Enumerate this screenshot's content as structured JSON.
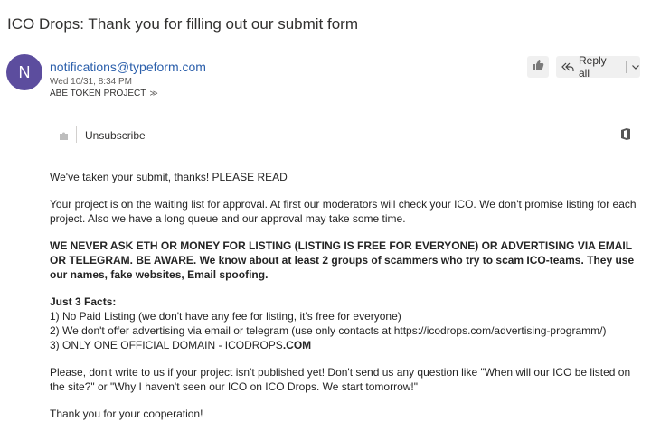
{
  "email": {
    "subject": "ICO Drops: Thank you for filling out our submit form",
    "avatar_letter": "N",
    "avatar_color": "#5c4d9e",
    "sender": "notifications@typeform.com",
    "date": "Wed 10/31, 8:34 PM",
    "to": "ABE TOKEN PROJECT",
    "reply_label": "Reply all",
    "unsubscribe_label": "Unsubscribe",
    "accent_color": "#2b5fab"
  },
  "icons": {
    "react": "thumbs-up-icon",
    "reply": "reply-all-icon",
    "dropdown": "chevron-down-icon",
    "plugin": "puzzle-icon",
    "office": "office-icon"
  },
  "body": {
    "line1": "We've taken your submit, thanks! PLEASE READ",
    "para1": "Your project is on the waiting list for approval. At first our moderators will check your ICO. We don't promise listing for each project. Also we have a long queue and our approval may take some time.",
    "warning": "WE NEVER ASK ETH OR MONEY FOR LISTING (LISTING IS FREE FOR EVERYONE) OR ADVERTISING VIA EMAIL OR TELEGRAM. BE AWARE. We know about at least 2 groups of scammers who try to scam ICO-teams. They use our names, fake websites, Email spoofing.",
    "facts_title": "Just 3 Facts:",
    "fact1": "1) No Paid Listing (we don't have any fee for listing, it's free for everyone)",
    "fact2": "2) We don't offer advertising via email or telegram (use only contacts at https://icodrops.com/advertising-programm/)",
    "fact3_prefix": "3) ONLY ONE OFFICIAL DOMAIN - ICODROPS",
    "fact3_suffix": ".COM",
    "para2": "Please, don't write to us if your project isn't published yet! Don't send us any question like \"When will our ICO be listed on the site?\" or \"Why I haven't seen our ICO on ICO Drops. We start tomorrow!\"",
    "thanks": "Thank you for your cooperation!"
  }
}
